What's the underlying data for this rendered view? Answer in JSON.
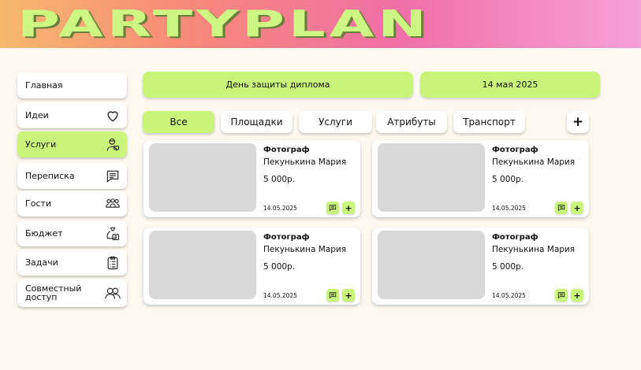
{
  "app": {
    "logo": "PARTYPLAN"
  },
  "colors": {
    "accent": "#c8f57a",
    "background": "#fdf9f1",
    "header_gradient": [
      "#f6b96c",
      "#f06fa6",
      "#f6a0d8"
    ]
  },
  "sidebar": {
    "items": [
      {
        "label": "Главная",
        "icon": ""
      },
      {
        "label": "Идеи",
        "icon": "heart-icon"
      },
      {
        "label": "Услуги",
        "icon": "service-person-icon",
        "active": true
      },
      {
        "label": "Переписка",
        "icon": "chat-icon"
      },
      {
        "label": "Гости",
        "icon": "guests-icon"
      },
      {
        "label": "Бюджет",
        "icon": "money-bag-icon"
      },
      {
        "label": "Задачи",
        "icon": "checklist-icon"
      },
      {
        "label": "Совместный доступ",
        "icon": "shared-users-icon"
      }
    ]
  },
  "event": {
    "name": "День защиты диплома",
    "date": "14 мая 2025"
  },
  "tabs": [
    {
      "label": "Все",
      "active": true
    },
    {
      "label": "Площадки"
    },
    {
      "label": "Услуги"
    },
    {
      "label": "Атрибуты"
    },
    {
      "label": "Транспорт"
    }
  ],
  "add_label": "+",
  "cards": [
    {
      "role": "Фотограф",
      "name": "Пекунькина Мария",
      "price": "5 000р.",
      "date": "14.05.2025"
    },
    {
      "role": "Фотограф",
      "name": "Пекунькина Мария",
      "price": "5 000р.",
      "date": "14.05.2025"
    },
    {
      "role": "Фотограф",
      "name": "Пекунькина Мария",
      "price": "5 000р.",
      "date": "14.05.2025"
    },
    {
      "role": "Фотограф",
      "name": "Пекунькина Мария",
      "price": "5 000р.",
      "date": "14.05.2025"
    }
  ]
}
